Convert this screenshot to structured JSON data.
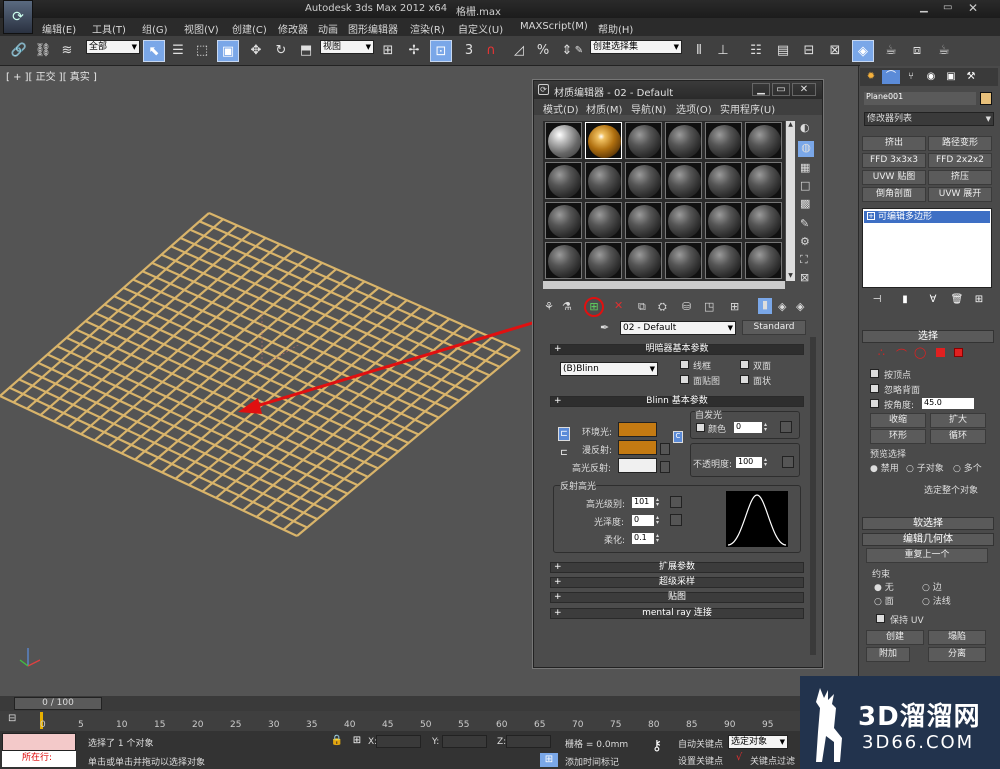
{
  "app": {
    "title": "Autodesk 3ds Max  2012 x64",
    "filename": "格栅.max"
  },
  "menu": [
    "编辑(E)",
    "工具(T)",
    "组(G)",
    "视图(V)",
    "创建(C)",
    "修改器",
    "动画",
    "图形编辑器",
    "渲染(R)",
    "自定义(U)",
    "MAXScript(M)",
    "帮助(H)"
  ],
  "toolbar": {
    "selection_filter": "全部",
    "ref_coord": "视图",
    "named_selection": "创建选择集",
    "snap_label": "3",
    "angle_snap": "△",
    "percent_snap": "%"
  },
  "viewport": {
    "label": "[ + ][ 正交 ][ 真实 ]"
  },
  "material_editor": {
    "title": "材质编辑器 - 02 - Default",
    "menus": [
      "模式(D)",
      "材质(M)",
      "导航(N)",
      "选项(O)",
      "实用程序(U)"
    ],
    "material_name": "02 - Default",
    "material_type": "Standard",
    "shader_rollout": "明暗器基本参数",
    "shader": "(B)Blinn",
    "wire": "线框",
    "two_sided": "双面",
    "face_map": "面贴图",
    "faceted": "面状",
    "blinn_rollout": "Blinn 基本参数",
    "self_illum": "自发光",
    "color": "颜色",
    "self_illum_value": "0",
    "ambient": "环境光:",
    "diffuse": "漫反射:",
    "specular": "高光反射:",
    "opacity": "不透明度:",
    "opacity_value": "100",
    "spec_highlights": "反射高光",
    "spec_level": "高光级别:",
    "spec_level_value": "101",
    "glossiness": "光泽度:",
    "glossiness_value": "0",
    "soften": "柔化:",
    "soften_value": "0.1",
    "rollouts": [
      "扩展参数",
      "超级采样",
      "贴图",
      "mental ray 连接"
    ],
    "ambient_color": "#c47a12",
    "diffuse_color": "#c47a12",
    "specular_color": "#f0f0f0"
  },
  "command_panel": {
    "object_name": "Plane001",
    "modifier_list": "修改器列表",
    "modifier_buttons": [
      "挤出",
      "路径变形",
      "FFD 3x3x3",
      "FFD 2x2x2",
      "UVW 贴图",
      "挤压",
      "倒角剖面",
      "UVW 展开"
    ],
    "stack_item": "可编辑多边形",
    "selection_rollout": "选择",
    "by_vertex": "按顶点",
    "ignore_backfacing": "忽略背面",
    "by_angle": "按角度:",
    "angle_value": "45.0",
    "shrink": "收缩",
    "grow": "扩大",
    "ring": "环形",
    "loop": "循环",
    "preview_selection": "预览选择",
    "disabled": "禁用",
    "subobject": "子对象",
    "multi": "多个",
    "select_whole": "选定整个对象",
    "soft_selection": "软选择",
    "edit_geometry": "编辑几何体",
    "repeat_last": "重复上一个",
    "constraints": "约束",
    "none": "无",
    "edge": "边",
    "face": "面",
    "normal": "法线",
    "preserve_uv": "保持 UV",
    "create": "创建",
    "collapse": "塌陷",
    "attach": "附加",
    "detach": "分离"
  },
  "timeline": {
    "frame": "0 / 100",
    "ticks": [
      "0",
      "5",
      "10",
      "15",
      "20",
      "25",
      "30",
      "35",
      "40",
      "45",
      "50",
      "55",
      "60",
      "65",
      "70",
      "75",
      "80",
      "85",
      "90",
      "95"
    ]
  },
  "status": {
    "running": "所在行:",
    "selected": "选择了 1 个对象",
    "hint": "单击或单击并拖动以选择对象",
    "x_label": "X:",
    "y_label": "Y:",
    "z_label": "Z:",
    "grid": "栅格 = 0.0mm",
    "add_time_tag": "添加时间标记",
    "auto_key": "自动关键点",
    "selected_obj": "选定对象",
    "set_key": "设置关键点",
    "key_filters": "关键点过滤"
  },
  "watermark": {
    "brand": "3D溜溜网",
    "url": "3D66.COM"
  },
  "colors": {
    "grid_wood": "#d9b46a",
    "arrow": "#e01010",
    "accent_blue": "#7aa7e8"
  }
}
